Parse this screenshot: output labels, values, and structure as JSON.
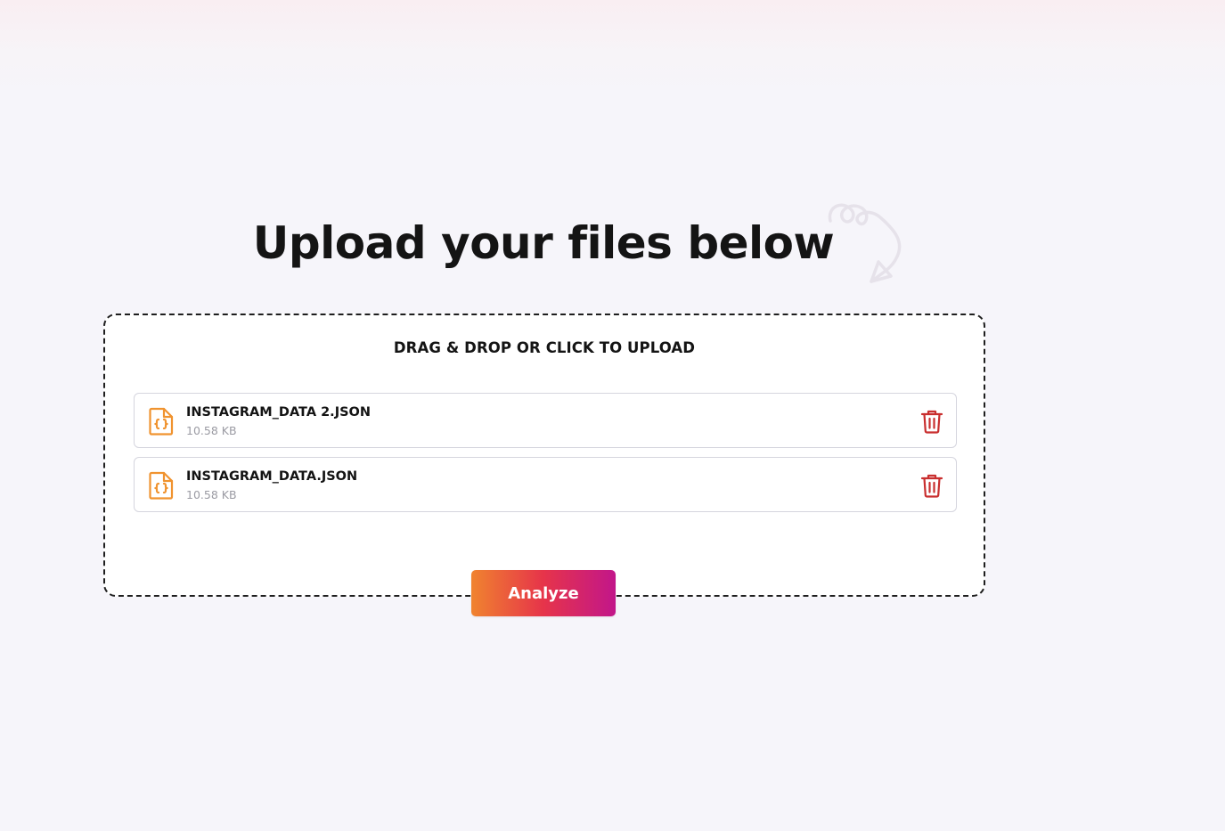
{
  "page": {
    "title": "Upload your files below"
  },
  "dropzone": {
    "label": "DRAG & DROP OR CLICK TO UPLOAD"
  },
  "files": [
    {
      "name": "INSTAGRAM_DATA 2.JSON",
      "size": "10.58 KB",
      "icon": "json-file-icon",
      "delete_icon": "trash-icon"
    },
    {
      "name": "INSTAGRAM_DATA.JSON",
      "size": "10.58 KB",
      "icon": "json-file-icon",
      "delete_icon": "trash-icon"
    }
  ],
  "actions": {
    "analyze_label": "Analyze"
  },
  "colors": {
    "file_icon": "#f0932f",
    "delete_icon": "#c92f2f",
    "gradient_start": "#f0832f",
    "gradient_mid": "#e6344a",
    "gradient_end": "#c2168a",
    "dash_border": "#1e1e1e"
  }
}
